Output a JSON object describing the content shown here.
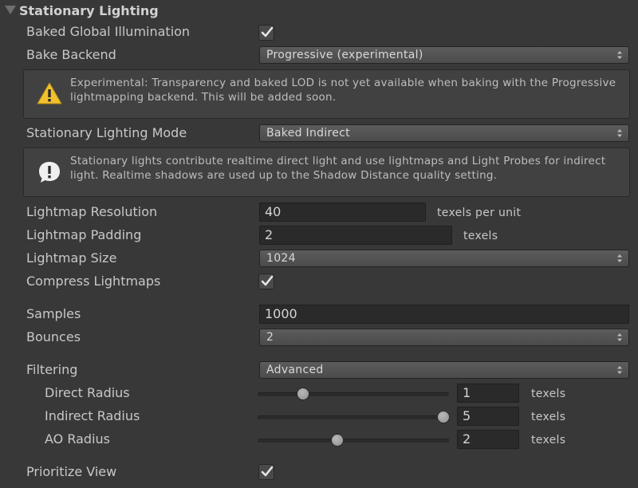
{
  "section": {
    "title": "Stationary Lighting"
  },
  "baked_gi": {
    "label": "Baked Global Illumination",
    "checked": true
  },
  "bake_backend": {
    "label": "Bake Backend",
    "value": "Progressive (experimental)"
  },
  "warning": {
    "text": "Experimental: Transparency and baked LOD is not yet available when baking with the Progressive lightmapping backend. This will be added soon.",
    "icon": "warning-icon"
  },
  "lighting_mode": {
    "label": "Stationary Lighting Mode",
    "value": "Baked Indirect"
  },
  "info": {
    "text": "Stationary lights contribute realtime direct light and use lightmaps and Light Probes for indirect light. Realtime shadows are used up to the Shadow Distance quality setting.",
    "icon": "info-icon"
  },
  "lightmap_resolution": {
    "label": "Lightmap Resolution",
    "value": "40",
    "unit": "texels per unit"
  },
  "lightmap_padding": {
    "label": "Lightmap Padding",
    "value": "2",
    "unit": "texels"
  },
  "lightmap_size": {
    "label": "Lightmap Size",
    "value": "1024"
  },
  "compress_lightmaps": {
    "label": "Compress Lightmaps",
    "checked": true
  },
  "samples": {
    "label": "Samples",
    "value": "1000"
  },
  "bounces": {
    "label": "Bounces",
    "value": "2"
  },
  "filtering": {
    "label": "Filtering",
    "value": "Advanced"
  },
  "direct_radius": {
    "label": "Direct Radius",
    "value": "1",
    "unit": "texels",
    "slider_fraction": 0.22
  },
  "indirect_radius": {
    "label": "Indirect Radius",
    "value": "5",
    "unit": "texels",
    "slider_fraction": 1.0
  },
  "ao_radius": {
    "label": "AO Radius",
    "value": "2",
    "unit": "texels",
    "slider_fraction": 0.41
  },
  "prioritize_view": {
    "label": "Prioritize View",
    "checked": true
  },
  "colors": {
    "background": "#383838",
    "text": "#c8c8c8",
    "warning": "#f2c12e"
  }
}
